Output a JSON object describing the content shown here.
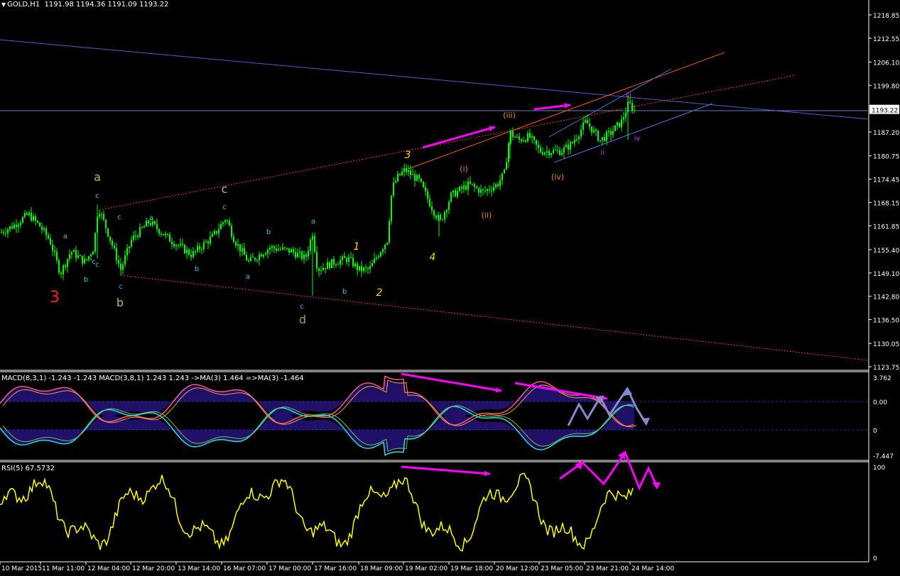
{
  "header": {
    "symbol": "GOLD,H1",
    "ohlc": "1191.98 1194.36 1191.09 1193.22"
  },
  "colors": {
    "background": "#000000",
    "candle": "#00ff00",
    "axis": "#ffffff",
    "trend_blue": "#4a60d0",
    "trend_orange": "#ff5a1a",
    "dotted_orange": "#e0461e",
    "arrow": "#ff00ff",
    "rsi": "#ffff00",
    "macd_fast": "#ff5a7a",
    "macd_slow": "#22ddee",
    "grey_path": "#8888cc"
  },
  "price_axis": {
    "labels": [
      "1218.85",
      "1212.55",
      "1206.10",
      "1199.80",
      "1187.20",
      "1180.75",
      "1174.45",
      "1168.15",
      "1161.85",
      "1155.40",
      "1149.10",
      "1142.80",
      "1136.50",
      "1130.05",
      "1123.75"
    ],
    "current": "1193.22"
  },
  "time_axis": [
    "10 Mar 2015",
    "11 Mar 11:00",
    "12 Mar 04:00",
    "12 Mar 20:00",
    "13 Mar 14:00",
    "16 Mar 07:00",
    "17 Mar 00:00",
    "17 Mar 16:00",
    "18 Mar 09:00",
    "19 Mar 02:00",
    "19 Mar 18:00",
    "20 Mar 12:00",
    "23 Mar 05:00",
    "23 Mar 21:00",
    "24 Mar 14:00"
  ],
  "macd": {
    "label": "MACD(8,3,1) -1.243 -1.243  MACD(3,8,1) 1.243 1.243  ->MA(3) 1.464  =>MA(3) -1.464",
    "axis": [
      "3.762",
      "0.00",
      "0",
      "-7.447"
    ]
  },
  "rsi": {
    "label": "RSI(5) 67.5732",
    "axis": [
      "100",
      "0"
    ]
  },
  "wave_labels": [
    {
      "text": "3",
      "color": "#ff2020",
      "size": 22
    },
    {
      "text": "a",
      "color": "#a8c84a",
      "size": 16
    },
    {
      "text": "b",
      "color": "#a8c84a",
      "size": 16
    },
    {
      "text": "c",
      "color": "#a8c84a",
      "size": 16
    },
    {
      "text": "d",
      "color": "#a8a040",
      "size": 16
    },
    {
      "text": "1",
      "color": "#ffd700",
      "size": 14
    },
    {
      "text": "2",
      "color": "#ffd700",
      "size": 14
    },
    {
      "text": "3",
      "color": "#ffd700",
      "size": 14
    },
    {
      "text": "4",
      "color": "#ffd700",
      "size": 14
    },
    {
      "text": "(i)",
      "color": "#e09030",
      "size": 11
    },
    {
      "text": "(ii)",
      "color": "#e09030",
      "size": 11
    },
    {
      "text": "(iii)",
      "color": "#e09030",
      "size": 11
    },
    {
      "text": "(iv)",
      "color": "#e09030",
      "size": 11
    },
    {
      "text": "iii",
      "color": "#c040e0",
      "size": 10
    },
    {
      "text": "ii",
      "color": "#c040e0",
      "size": 10
    },
    {
      "text": "iv",
      "color": "#c040e0",
      "size": 10
    },
    {
      "text": "a",
      "color": "#40c0e0",
      "size": 10
    },
    {
      "text": "b",
      "color": "#40c0e0",
      "size": 10
    },
    {
      "text": "c",
      "color": "#40c0e0",
      "size": 10
    }
  ]
}
